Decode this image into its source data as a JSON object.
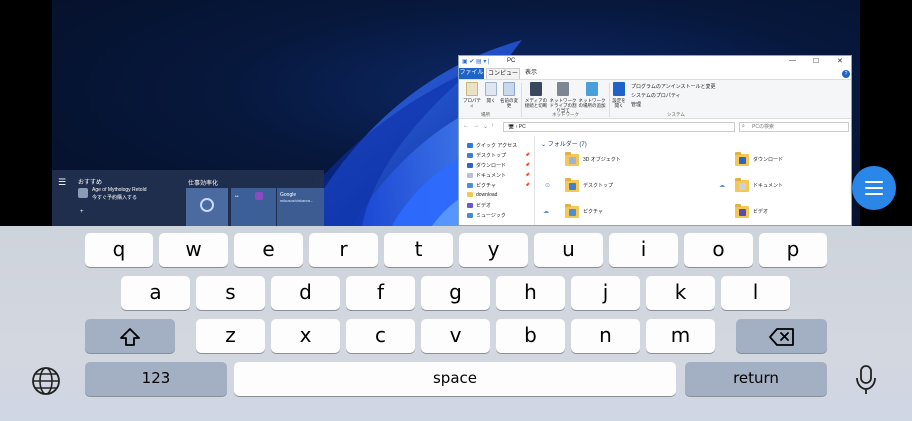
{
  "explorer": {
    "window_title": "PC",
    "tabs": [
      "ファイル",
      "コンピューター",
      "表示"
    ],
    "ribbon_buttons": [
      "プロパティ",
      "開く",
      "名前の変更",
      "メディアの接続と切断",
      "ネットワークドライブの割り当て",
      "ネットワークの場所の追加",
      "設定を開く"
    ],
    "ribbon_right": [
      "プログラムのアンインストールと変更",
      "システムのプロパティ",
      "管理"
    ],
    "ribbon_groups": [
      "場所",
      "ネットワーク",
      "システム"
    ],
    "address": "PC",
    "search_placeholder": "PCの検索",
    "nav_items": [
      "クイック アクセス",
      "デスクトップ",
      "ダウンロード",
      "ドキュメント",
      "ピクチャ",
      "download",
      "ビデオ",
      "ミュージック"
    ],
    "section_header": "フォルダー (7)",
    "folders": [
      "3D オブジェクト",
      "ダウンロード",
      "デスクトップ",
      "ドキュメント",
      "ピクチャ",
      "ビデオ"
    ]
  },
  "start_menu": {
    "recommended_title": "おすすめ",
    "recommended_item_title": "Age of Mythology Retold",
    "recommended_item_sub": "今すぐ予約購入する",
    "add_label": "+",
    "pinned_title": "仕事効率化",
    "tile_google_title": "Google",
    "tile_google_sub": "mikusoshinkanra..."
  },
  "keyboard": {
    "row1": [
      "q",
      "w",
      "e",
      "r",
      "t",
      "y",
      "u",
      "i",
      "o",
      "p"
    ],
    "row2": [
      "a",
      "s",
      "d",
      "f",
      "g",
      "h",
      "j",
      "k",
      "l"
    ],
    "row3": [
      "z",
      "x",
      "c",
      "v",
      "b",
      "n",
      "m"
    ],
    "numbers_label": "123",
    "space_label": "space",
    "return_label": "return"
  },
  "icons": {
    "shift": "shift-icon",
    "backspace": "backspace-icon",
    "globe": "globe-icon",
    "mic": "microphone-icon",
    "menu": "menu-icon"
  },
  "colors": {
    "fab": "#2a87e8",
    "keyboard_bg": "#d1d5dc",
    "key": "#fdfdfe",
    "key_dark": "#a3afc2",
    "explorer_accent": "#1f63c6"
  }
}
